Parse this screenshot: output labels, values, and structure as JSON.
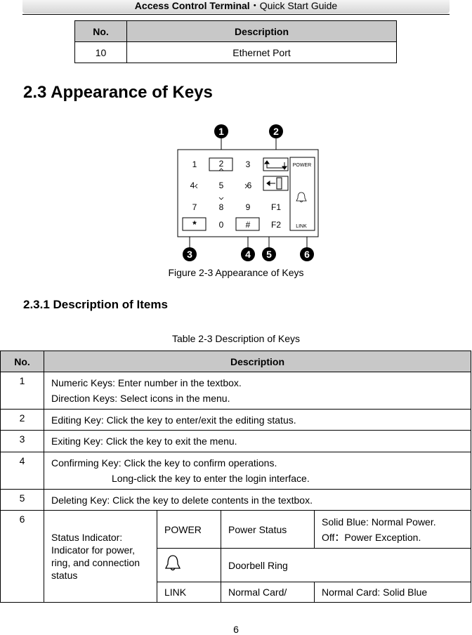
{
  "header": {
    "title_bold": "Access Control Terminal",
    "separator": "・",
    "title_regular": "Quick Start Guide"
  },
  "top_table": {
    "headers": [
      "No.",
      "Description"
    ],
    "rows": [
      {
        "no": "10",
        "description": "Ethernet Port"
      }
    ]
  },
  "section_heading": "2.3 Appearance of Keys",
  "figure": {
    "caption": "Figure 2-3 Appearance of Keys",
    "callouts": [
      "1",
      "2",
      "3",
      "4",
      "5",
      "6"
    ],
    "keys": {
      "row1": [
        "1",
        "2",
        "3"
      ],
      "row2": [
        "4",
        "5",
        "6"
      ],
      "row3": [
        "7",
        "8",
        "9",
        "F1"
      ],
      "row4": [
        "*",
        "0",
        "#",
        "F2"
      ],
      "power_label": "POWER",
      "link_label": "LINK"
    }
  },
  "subsection_heading": "2.3.1 Description of Items",
  "table_caption": "Table 2-3 Description of Keys",
  "keys_table": {
    "headers": [
      "No.",
      "Description"
    ],
    "rows": [
      {
        "no": "1",
        "lines": [
          "Numeric Keys: Enter number in the textbox.",
          "Direction Keys: Select icons in the menu."
        ]
      },
      {
        "no": "2",
        "lines": [
          "Editing Key: Click the key to enter/exit the editing status."
        ]
      },
      {
        "no": "3",
        "lines": [
          "Exiting Key: Click the key to exit the menu."
        ]
      },
      {
        "no": "4",
        "lines": [
          "Confirming Key: Click the key to confirm operations.",
          "Long-click the key to enter the login interface."
        ]
      },
      {
        "no": "5",
        "lines": [
          "Deleting Key: Click the key to delete contents in the textbox."
        ]
      },
      {
        "no": "6",
        "label": "Status Indicator: Indicator for power, ring, and connection status",
        "sub_rows": [
          {
            "indicator": "POWER",
            "name": "Power Status",
            "lines": [
              "Solid Blue: Normal Power.",
              "Off：Power Exception."
            ]
          },
          {
            "indicator_icon": "bell-icon",
            "name": "Doorbell Ring"
          },
          {
            "indicator": "LINK",
            "name": "Normal Card/",
            "lines": [
              "Normal Card: Solid Blue"
            ]
          }
        ]
      }
    ]
  },
  "page_number": "6"
}
